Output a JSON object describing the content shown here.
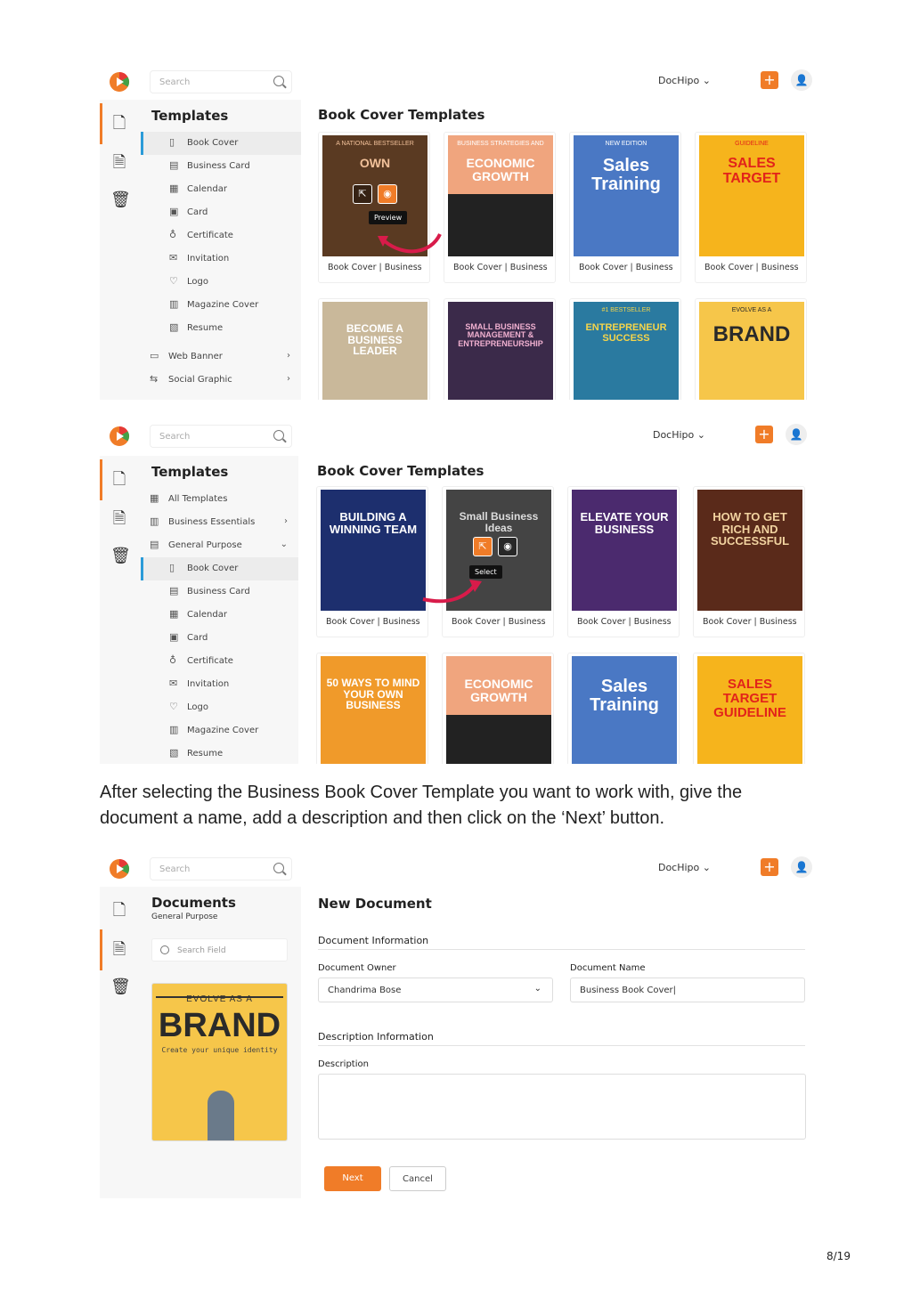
{
  "app": {
    "search_placeholder": "Search",
    "user_name": "DocHipo",
    "add_label": "+"
  },
  "shot1": {
    "sidebar_title": "Templates",
    "items": [
      {
        "label": "Book Cover",
        "icon": "book-icon"
      },
      {
        "label": "Business Card",
        "icon": "id-card-icon"
      },
      {
        "label": "Calendar",
        "icon": "calendar-icon"
      },
      {
        "label": "Card",
        "icon": "card-icon"
      },
      {
        "label": "Certificate",
        "icon": "ribbon-icon"
      },
      {
        "label": "Invitation",
        "icon": "envelope-icon"
      },
      {
        "label": "Logo",
        "icon": "heart-icon"
      },
      {
        "label": "Magazine Cover",
        "icon": "magazine-icon"
      },
      {
        "label": "Resume",
        "icon": "resume-icon"
      },
      {
        "label": "Web Banner",
        "icon": "banner-icon"
      },
      {
        "label": "Social Graphic",
        "icon": "share-icon"
      }
    ],
    "main_title": "Book Cover Templates",
    "preview_tooltip": "Preview",
    "cards": [
      {
        "caption": "Book Cover | Business",
        "title": "OWN",
        "top": "A NATIONAL BESTSELLER"
      },
      {
        "caption": "Book Cover | Business",
        "title": "ECONOMIC GROWTH",
        "top": "BUSINESS STRATEGIES AND"
      },
      {
        "caption": "Book Cover | Business",
        "title": "Sales Training",
        "top": "NEW EDITION"
      },
      {
        "caption": "Book Cover | Business",
        "title": "SALES TARGET",
        "top": "GUIDELINE"
      },
      {
        "caption": "",
        "title": "BECOME A BUSINESS LEADER",
        "top": ""
      },
      {
        "caption": "",
        "title": "SMALL BUSINESS MANAGEMENT & ENTREPRENEURSHIP",
        "top": ""
      },
      {
        "caption": "",
        "title": "ENTREPRENEUR SUCCESS",
        "top": "#1 BESTSELLER"
      },
      {
        "caption": "",
        "title": "BRAND",
        "top": "EVOLVE AS A"
      }
    ]
  },
  "shot2": {
    "sidebar_title": "Templates",
    "items": [
      {
        "label": "All Templates",
        "icon": "grid-icon",
        "level": 0
      },
      {
        "label": "Business Essentials",
        "icon": "building-icon",
        "level": 0
      },
      {
        "label": "General Purpose",
        "icon": "folder-icon",
        "level": 0
      },
      {
        "label": "Book Cover",
        "icon": "book-icon",
        "level": 1
      },
      {
        "label": "Business Card",
        "icon": "id-card-icon",
        "level": 1
      },
      {
        "label": "Calendar",
        "icon": "calendar-icon",
        "level": 1
      },
      {
        "label": "Card",
        "icon": "card-icon",
        "level": 1
      },
      {
        "label": "Certificate",
        "icon": "ribbon-icon",
        "level": 1
      },
      {
        "label": "Invitation",
        "icon": "envelope-icon",
        "level": 1
      },
      {
        "label": "Logo",
        "icon": "heart-icon",
        "level": 1
      },
      {
        "label": "Magazine Cover",
        "icon": "magazine-icon",
        "level": 1
      },
      {
        "label": "Resume",
        "icon": "resume-icon",
        "level": 1
      }
    ],
    "main_title": "Book Cover Templates",
    "select_tooltip": "Select",
    "cards": [
      {
        "caption": "Book Cover | Business",
        "title": "BUILDING A WINNING TEAM"
      },
      {
        "caption": "Book Cover | Business",
        "title": "Small Business Ideas"
      },
      {
        "caption": "Book Cover | Business",
        "title": "ELEVATE YOUR BUSINESS"
      },
      {
        "caption": "Book Cover | Business",
        "title": "HOW TO GET RICH AND SUCCESSFUL"
      },
      {
        "caption": "",
        "title": "50 WAYS TO MIND YOUR OWN BUSINESS"
      },
      {
        "caption": "",
        "title": "ECONOMIC GROWTH"
      },
      {
        "caption": "",
        "title": "Sales Training"
      },
      {
        "caption": "",
        "title": "SALES TARGET GUIDELINE"
      }
    ]
  },
  "caption": "After selecting the Business Book Cover Template you want to work with, give the document a name, add a description and then click on the ‘Next’ button.",
  "shot3": {
    "sidebar_title": "Documents",
    "sidebar_subtitle": "General Purpose",
    "search_field_placeholder": "Search Field",
    "thumb_title": "BRAND",
    "thumb_top": "EVOLVE AS A",
    "thumb_sub": "Create your unique identity",
    "main_title": "New Document",
    "doc_info_label": "Document Information",
    "owner_label": "Document Owner",
    "owner_value": "Chandrima Bose",
    "name_label": "Document Name",
    "name_value": "Business Book Cover",
    "desc_info_label": "Description Information",
    "desc_label": "Description",
    "next_label": "Next",
    "cancel_label": "Cancel"
  },
  "page_number": "8/19",
  "colors": {
    "accent": "#f07c28",
    "select_bar": "#2b9bd8",
    "sidebar_bg": "#f7f7f7"
  }
}
